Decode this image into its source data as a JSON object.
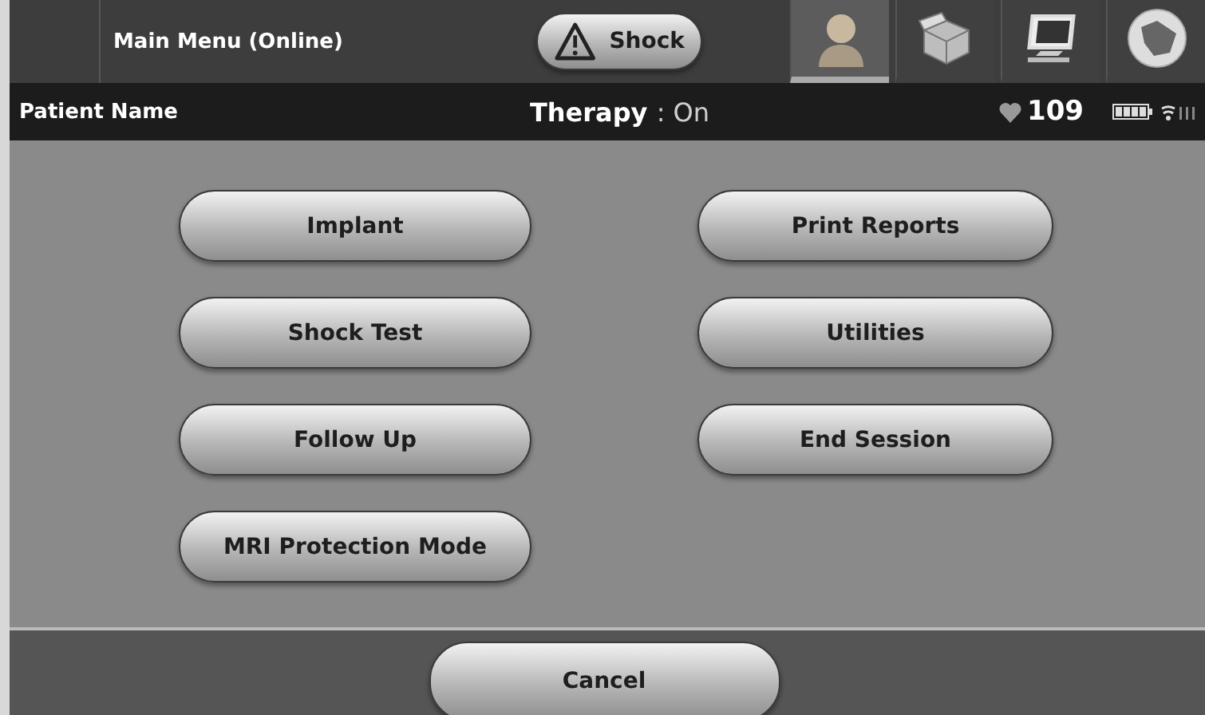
{
  "top_bar": {
    "title": "Main Menu (Online)",
    "shock_button": {
      "label": "Shock"
    },
    "tabs": [
      {
        "kind": "patient",
        "selected": true
      },
      {
        "kind": "box",
        "selected": false
      },
      {
        "kind": "computer",
        "selected": false
      },
      {
        "kind": "globe",
        "selected": false
      }
    ]
  },
  "patient_bar": {
    "patient_name": "Patient Name",
    "therapy_label": "Therapy",
    "therapy_value": ": On",
    "heart_rate": "109"
  },
  "menu": {
    "buttons": [
      {
        "label": "Implant"
      },
      {
        "label": "Print Reports"
      },
      {
        "label": "Shock Test"
      },
      {
        "label": "Utilities"
      },
      {
        "label": "Follow Up"
      },
      {
        "label": "End Session"
      },
      {
        "label": "MRI Protection Mode"
      }
    ]
  },
  "footer": {
    "cancel_button": {
      "label": "Cancel"
    }
  }
}
